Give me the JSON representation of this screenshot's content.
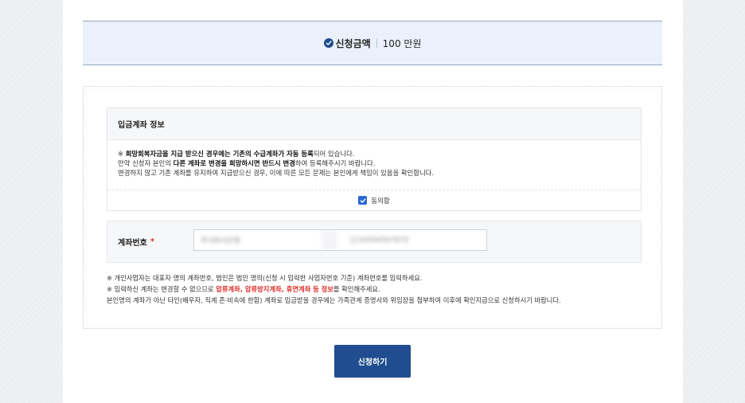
{
  "amount_bar": {
    "label": "신청금액",
    "value": "100 만원"
  },
  "account_info": {
    "title": "입금계좌 정보",
    "notice": {
      "line1_pre": "※ ",
      "line1_bold": "희망회복자금을 지급 받으신 경우에는 기존의 수급계좌가 자동 등록",
      "line1_post": "되어 있습니다.",
      "line2_pre": "만약 신청자 본인의 ",
      "line2_bold": "다른 계좌로 변경을 희망하시면 반드시 변경",
      "line2_post": "하여 등록해주시기 바랍니다.",
      "line3": "변경하지 않고 기존 계좌를 유지하여 지급받으신 경우, 이에 따른 모든 문제는 본인에게 책임이 있음을 확인합니다."
    },
    "agree": {
      "label": "동의함",
      "checked": true
    }
  },
  "account_number": {
    "label": "계좌번호",
    "required_mark": "*",
    "bank_masked": "주식회사은행",
    "number_masked": "1234564567879"
  },
  "bottom_notes": {
    "line1": "※ 개인사업자는 대표자 명의 계좌번호, 법인은 법인 명의(신청 시 입력한 사업자번호 기준) 계좌번호를 입력하세요.",
    "line2_pre": "※ 입력하신 계좌는 변경할 수 없으므로 ",
    "line2_red": "압류계좌, 압류방지계좌, 휴면계좌 등 정보",
    "line2_post": "를 확인해주세요.",
    "line3": "본인명의 계좌가 아닌 타인(배우자, 직계 존·비속에 한함) 계좌로 입금받을 경우에는 가족관계 증명서와 위임장을 첨부하여 이후에 확인지급으로 신청하시기 바랍니다."
  },
  "submit": {
    "label": "신청하기"
  },
  "colors": {
    "primary": "#1f4d8f",
    "checkbox": "#2a67d3",
    "required": "#e0312b",
    "amount_bg": "#eaf1fb"
  },
  "icons": {
    "amount_check": "check-circle-icon",
    "agree_check": "checkbox-checked-icon"
  }
}
